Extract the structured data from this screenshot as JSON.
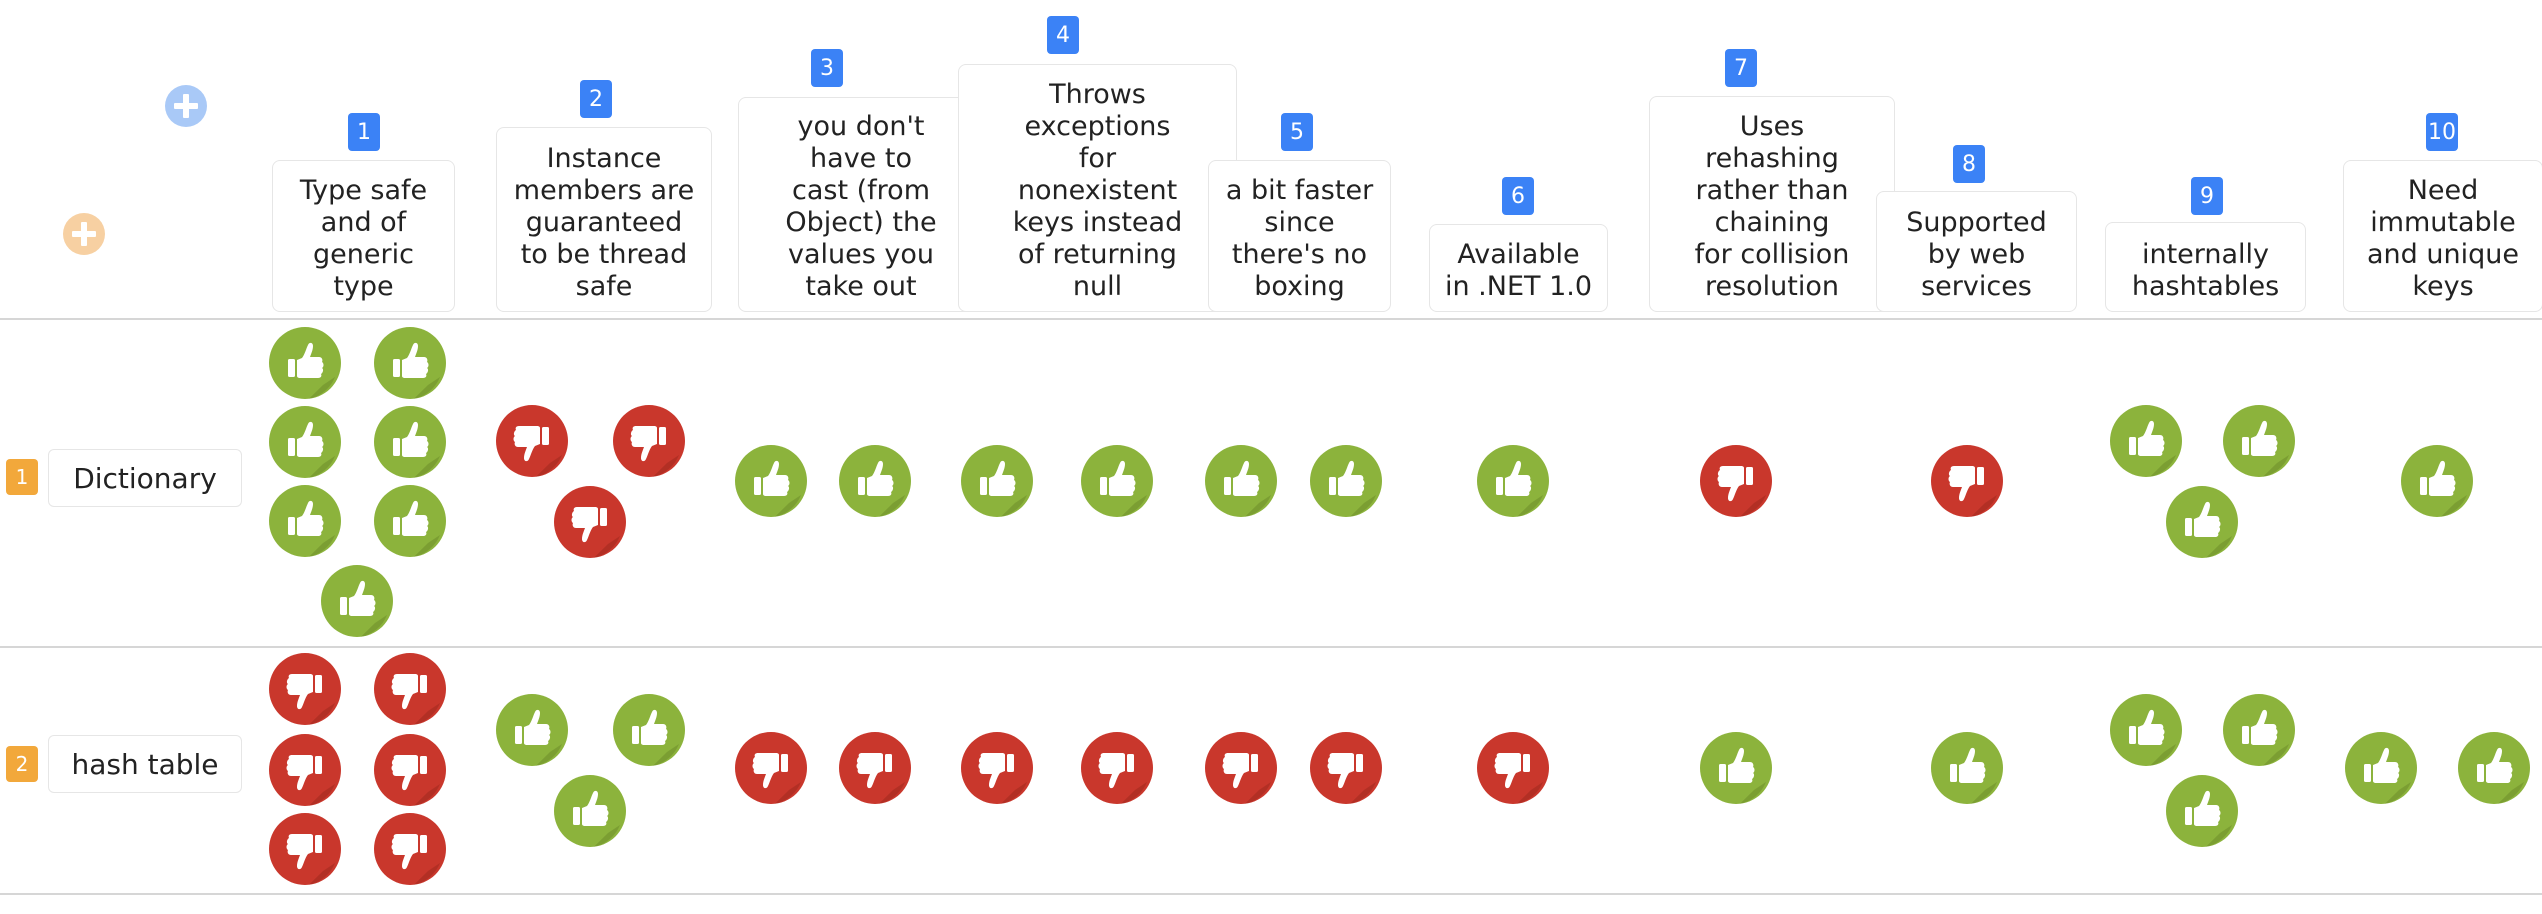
{
  "columns": [
    {
      "num": "1",
      "lines": [
        "Type safe",
        "and of",
        "generic",
        "type"
      ]
    },
    {
      "num": "2",
      "lines": [
        "Instance",
        "members are",
        "guaranteed",
        "to be thread",
        "safe"
      ]
    },
    {
      "num": "3",
      "lines": [
        "you don't",
        "have to",
        "cast (from",
        "Object) the",
        "values you",
        "take out"
      ]
    },
    {
      "num": "4",
      "lines": [
        "Throws",
        "exceptions",
        "for",
        "nonexistent",
        "keys instead",
        "of returning",
        "null"
      ]
    },
    {
      "num": "5",
      "lines": [
        "a bit faster",
        "since",
        "there's no",
        "boxing"
      ]
    },
    {
      "num": "6",
      "lines": [
        "Available",
        "in .NET 1.0"
      ]
    },
    {
      "num": "7",
      "lines": [
        "Uses",
        "rehashing",
        "rather than",
        "chaining",
        "for collision",
        "resolution"
      ]
    },
    {
      "num": "8",
      "lines": [
        "Supported",
        "by web",
        "services"
      ]
    },
    {
      "num": "9",
      "lines": [
        "internally",
        "hashtables"
      ]
    },
    {
      "num": "10",
      "lines": [
        "Need",
        "immutable",
        "and unique",
        "keys"
      ]
    }
  ],
  "rows": [
    {
      "num": "1",
      "label": "Dictionary"
    },
    {
      "num": "2",
      "label": "hash table"
    }
  ],
  "votes": [
    [
      "up",
      "up",
      "up",
      "up",
      "up",
      "up",
      "up",
      "down",
      "down",
      "down",
      "up",
      "up",
      "up",
      "up",
      "up",
      "up",
      "up",
      "down",
      "down",
      "up",
      "up",
      "up",
      "up"
    ],
    [
      "down",
      "down",
      "down",
      "down",
      "down",
      "down",
      "up",
      "up",
      "up",
      "down",
      "down",
      "down",
      "down",
      "down",
      "down",
      "down",
      "up",
      "up",
      "up",
      "up",
      "up",
      "up",
      "up"
    ]
  ],
  "colors": {
    "up": "#8cb33c",
    "up_shadow": "#6f8f2c",
    "down": "#c9372c",
    "down_shadow": "#a32a20",
    "col_badge": "#3b82f6",
    "row_badge": "#f2a83b",
    "add_col": "#a9c9f7",
    "add_row": "#f7d0a2"
  },
  "icons": {
    "add_column": "plus-circle-icon",
    "add_row": "plus-circle-icon",
    "up": "thumbs-up-icon",
    "down": "thumbs-down-icon"
  }
}
